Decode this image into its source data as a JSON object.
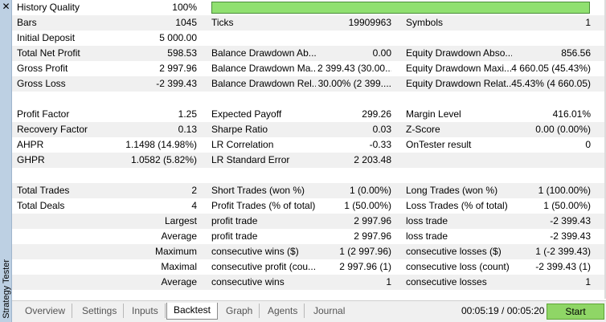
{
  "side": {
    "title": "Strategy Tester",
    "close": "✕"
  },
  "rows": [
    [
      "History Quality",
      "100%",
      "",
      "",
      "",
      ""
    ],
    [
      "Bars",
      "1045",
      "Ticks",
      "19909963",
      "Symbols",
      "1"
    ],
    [
      "Initial Deposit",
      "5 000.00",
      "",
      "",
      "",
      ""
    ],
    [
      "Total Net Profit",
      "598.53",
      "Balance Drawdown Ab...",
      "0.00",
      "Equity Drawdown Abso...",
      "856.56"
    ],
    [
      "Gross Profit",
      "2 997.96",
      "Balance Drawdown Ma...",
      "2 399.43 (30.00...",
      "Equity Drawdown Maxi...",
      "4 660.05 (45.43%)"
    ],
    [
      "Gross Loss",
      "-2 399.43",
      "Balance Drawdown Rel...",
      "30.00% (2 399....",
      "Equity Drawdown Relat...",
      "45.43% (4 660.05)"
    ],
    [
      "",
      "",
      "",
      "",
      "",
      ""
    ],
    [
      "Profit Factor",
      "1.25",
      "Expected Payoff",
      "299.26",
      "Margin Level",
      "416.01%"
    ],
    [
      "Recovery Factor",
      "0.13",
      "Sharpe Ratio",
      "0.03",
      "Z-Score",
      "0.00 (0.00%)"
    ],
    [
      "AHPR",
      "1.1498 (14.98%)",
      "LR Correlation",
      "-0.33",
      "OnTester result",
      "0"
    ],
    [
      "GHPR",
      "1.0582 (5.82%)",
      "LR Standard Error",
      "2 203.48",
      "",
      ""
    ],
    [
      "",
      "",
      "",
      "",
      "",
      ""
    ],
    [
      "Total Trades",
      "2",
      "Short Trades (won %)",
      "1 (0.00%)",
      "Long Trades (won %)",
      "1 (100.00%)"
    ],
    [
      "Total Deals",
      "4",
      "Profit Trades (% of total)",
      "1 (50.00%)",
      "Loss Trades (% of total)",
      "1 (50.00%)"
    ],
    [
      "",
      "Largest",
      "profit trade",
      "2 997.96",
      "loss trade",
      "-2 399.43"
    ],
    [
      "",
      "Average",
      "profit trade",
      "2 997.96",
      "loss trade",
      "-2 399.43"
    ],
    [
      "",
      "Maximum",
      "consecutive wins ($)",
      "1 (2 997.96)",
      "consecutive losses ($)",
      "1 (-2 399.43)"
    ],
    [
      "",
      "Maximal",
      "consecutive profit (cou...",
      "2 997.96 (1)",
      "consecutive loss (count)",
      "-2 399.43 (1)"
    ],
    [
      "",
      "Average",
      "consecutive wins",
      "1",
      "consecutive losses",
      "1"
    ]
  ],
  "history_quality_fraction": 1.0,
  "tabs": [
    "Overview",
    "Settings",
    "Inputs",
    "Backtest",
    "Graph",
    "Agents",
    "Journal"
  ],
  "active_tab": "Backtest",
  "time": "00:05:19 / 00:05:20",
  "start_label": "Start"
}
